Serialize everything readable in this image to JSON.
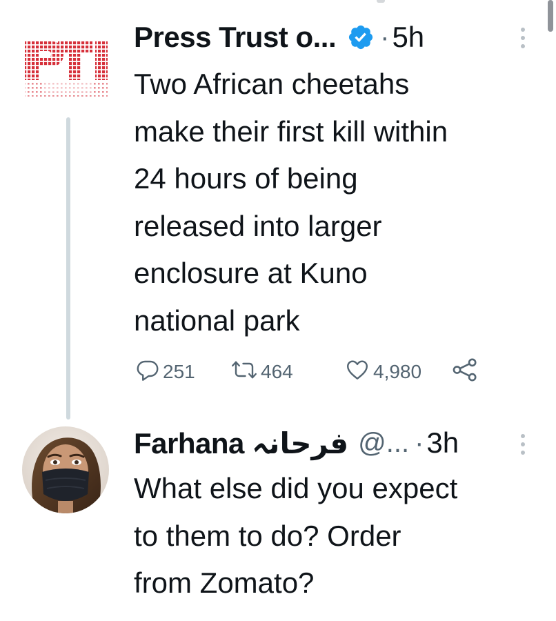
{
  "tweet": {
    "author_name": "Press Trust o...",
    "dot": "·",
    "time": "5h",
    "text": "Two African cheetahs\nmake their first kill within\n24 hours of being\nreleased into larger\nenclosure at Kuno\nnational park",
    "avatar_icon": "pti-logo-icon",
    "verified_icon": "verified-badge-icon",
    "stats": {
      "replies": "251",
      "retweets": "464",
      "likes": "4,980"
    },
    "icons": {
      "reply": "reply-icon",
      "retweet": "retweet-icon",
      "like": "heart-icon",
      "share": "share-icon"
    }
  },
  "reply": {
    "author_name": "Farhana فرحانہ",
    "handle": "@...",
    "dot": "·",
    "time": "3h",
    "text": "What else did you expect\nto them to do? Order\nfrom Zomato?"
  },
  "colors": {
    "verified": "#1d9bf0",
    "secondary_text": "#536471",
    "primary_text": "#0f1419",
    "thread_line": "#cfd9de",
    "pti_logo": "#d6303a"
  }
}
